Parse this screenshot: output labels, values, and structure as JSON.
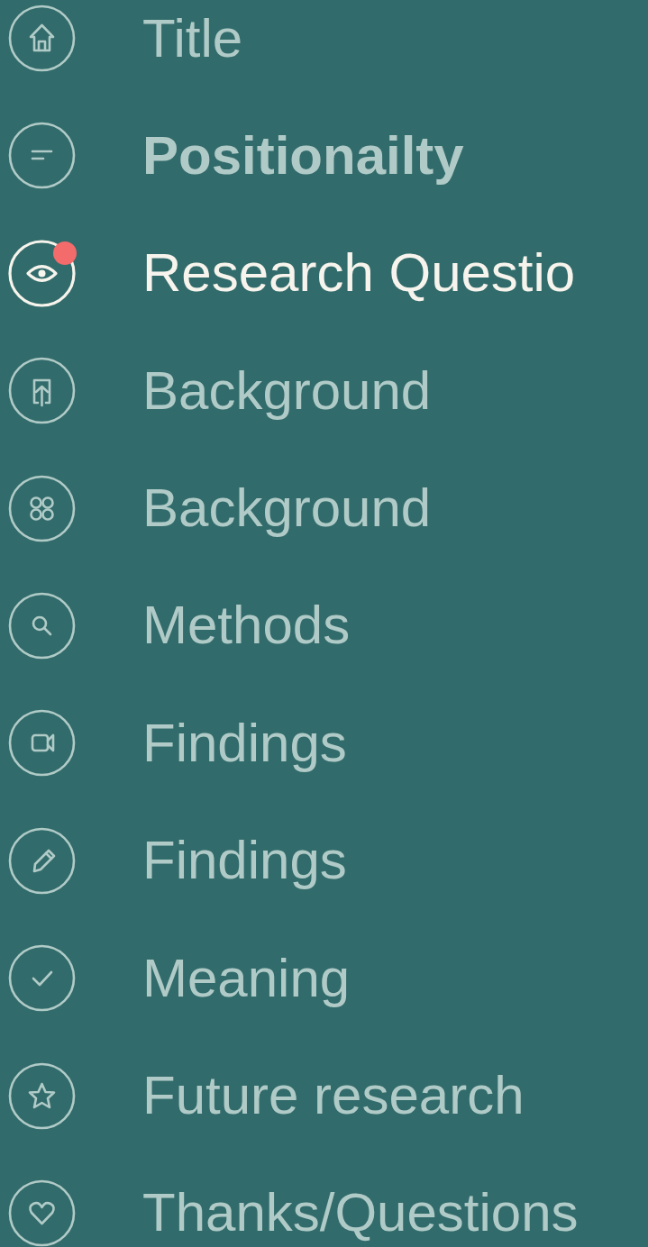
{
  "menu": {
    "items": [
      {
        "label": "Title",
        "selected": false,
        "bold": false,
        "badge": false
      },
      {
        "label": "Positionailty",
        "selected": false,
        "bold": true,
        "badge": false
      },
      {
        "label": "Research Questio",
        "selected": true,
        "bold": false,
        "badge": true
      },
      {
        "label": "Background",
        "selected": false,
        "bold": false,
        "badge": false
      },
      {
        "label": "Background",
        "selected": false,
        "bold": false,
        "badge": false
      },
      {
        "label": "Methods",
        "selected": false,
        "bold": false,
        "badge": false
      },
      {
        "label": "Findings",
        "selected": false,
        "bold": false,
        "badge": false
      },
      {
        "label": "Findings",
        "selected": false,
        "bold": false,
        "badge": false
      },
      {
        "label": "Meaning",
        "selected": false,
        "bold": false,
        "badge": false
      },
      {
        "label": "Future research",
        "selected": false,
        "bold": false,
        "badge": false
      },
      {
        "label": "Thanks/Questions",
        "selected": false,
        "bold": false,
        "badge": false
      }
    ]
  }
}
